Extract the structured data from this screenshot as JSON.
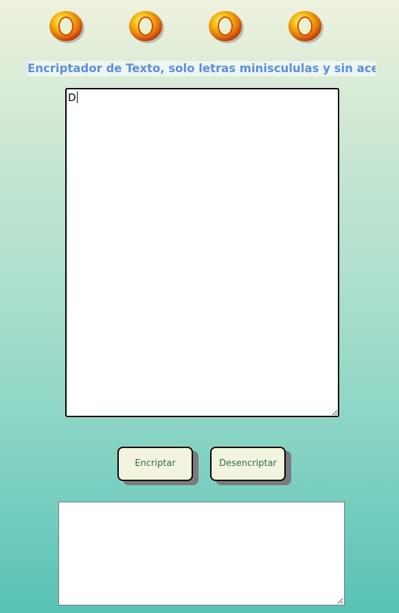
{
  "logos": [
    {
      "icon": "gold-ring-icon"
    },
    {
      "icon": "gold-ring-icon"
    },
    {
      "icon": "gold-ring-icon"
    },
    {
      "icon": "gold-ring-icon"
    }
  ],
  "title": "Encriptador de Texto, solo letras miniscululas y sin acento",
  "input": {
    "value": "D",
    "placeholder": ""
  },
  "buttons": {
    "encrypt_label": "Encriptar",
    "decrypt_label": "Desencriptar"
  },
  "output": {
    "value": "",
    "placeholder": ""
  },
  "colors": {
    "title": "#5b8fdc",
    "button_bg": "#f3f4dd",
    "button_text": "#2c6c4f",
    "gradient_top": "#eef2dd",
    "gradient_bottom": "#58c2b6"
  }
}
